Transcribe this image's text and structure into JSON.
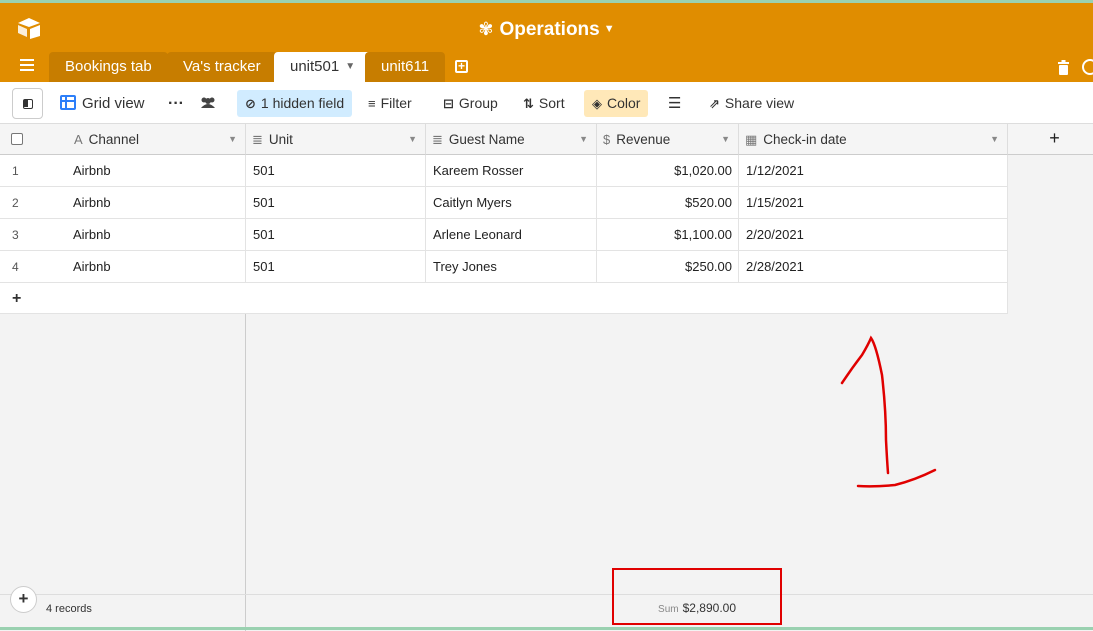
{
  "header": {
    "base_name": "Operations",
    "tabs": [
      "Bookings tab",
      "Va's tracker",
      "unit501",
      "unit611"
    ],
    "active_tab": "unit501"
  },
  "toolbar": {
    "view_name": "Grid view",
    "hidden_fields": "1 hidden field",
    "filter": "Filter",
    "group": "Group",
    "sort": "Sort",
    "color": "Color",
    "share": "Share view"
  },
  "grid": {
    "columns": [
      "Channel",
      "Unit",
      "Guest Name",
      "Revenue",
      "Check-in date"
    ],
    "rows": [
      {
        "num": "1",
        "channel": "Airbnb",
        "unit": "501",
        "guest": "Kareem Rosser",
        "revenue": "$1,020.00",
        "checkin": "1/12/2021"
      },
      {
        "num": "2",
        "channel": "Airbnb",
        "unit": "501",
        "guest": "Caitlyn Myers",
        "revenue": "$520.00",
        "checkin": "1/15/2021"
      },
      {
        "num": "3",
        "channel": "Airbnb",
        "unit": "501",
        "guest": "Arlene Leonard",
        "revenue": "$1,100.00",
        "checkin": "2/20/2021"
      },
      {
        "num": "4",
        "channel": "Airbnb",
        "unit": "501",
        "guest": "Trey Jones",
        "revenue": "$250.00",
        "checkin": "2/28/2021"
      }
    ]
  },
  "footer": {
    "records": "4 records",
    "sum_label": "Sum",
    "sum_value": "$2,890.00"
  },
  "colors": {
    "header": "#e08d00",
    "tab_inactive": "#c77d00",
    "accent_blue": "#2d7ff9",
    "annotation_red": "#e00000"
  }
}
